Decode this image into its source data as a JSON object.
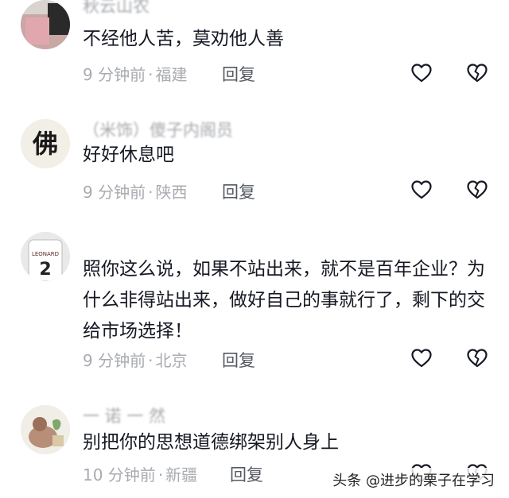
{
  "comments": [
    {
      "username": "秋云山农",
      "text": "不经他人苦，莫劝他人善",
      "time": "9 分钟前",
      "location": "福建",
      "reply": "回复"
    },
    {
      "username": "（米饰）傻子内阁员",
      "text": "好好休息吧",
      "time": "9 分钟前",
      "location": "陕西",
      "reply": "回复"
    },
    {
      "username": "",
      "text": "照你这么说，如果不站出来，就不是百年企业？为什么非得站出来，做好自己的事就行了，剩下的交给市场选择！",
      "time": "9 分钟前",
      "location": "北京",
      "reply": "回复"
    },
    {
      "username": "一 诺 一 然",
      "text": "别把你的思想道德绑架别人身上",
      "time": "10 分钟前",
      "location": "新疆",
      "reply": "回复"
    }
  ],
  "watermark": "头条 @进步的栗子在学习",
  "icons": {
    "like": "heart-icon",
    "dislike": "broken-heart-icon"
  },
  "colors": {
    "text": "#161823",
    "meta": "#a9abb0",
    "reply": "#555a61",
    "icon": "#161823"
  }
}
